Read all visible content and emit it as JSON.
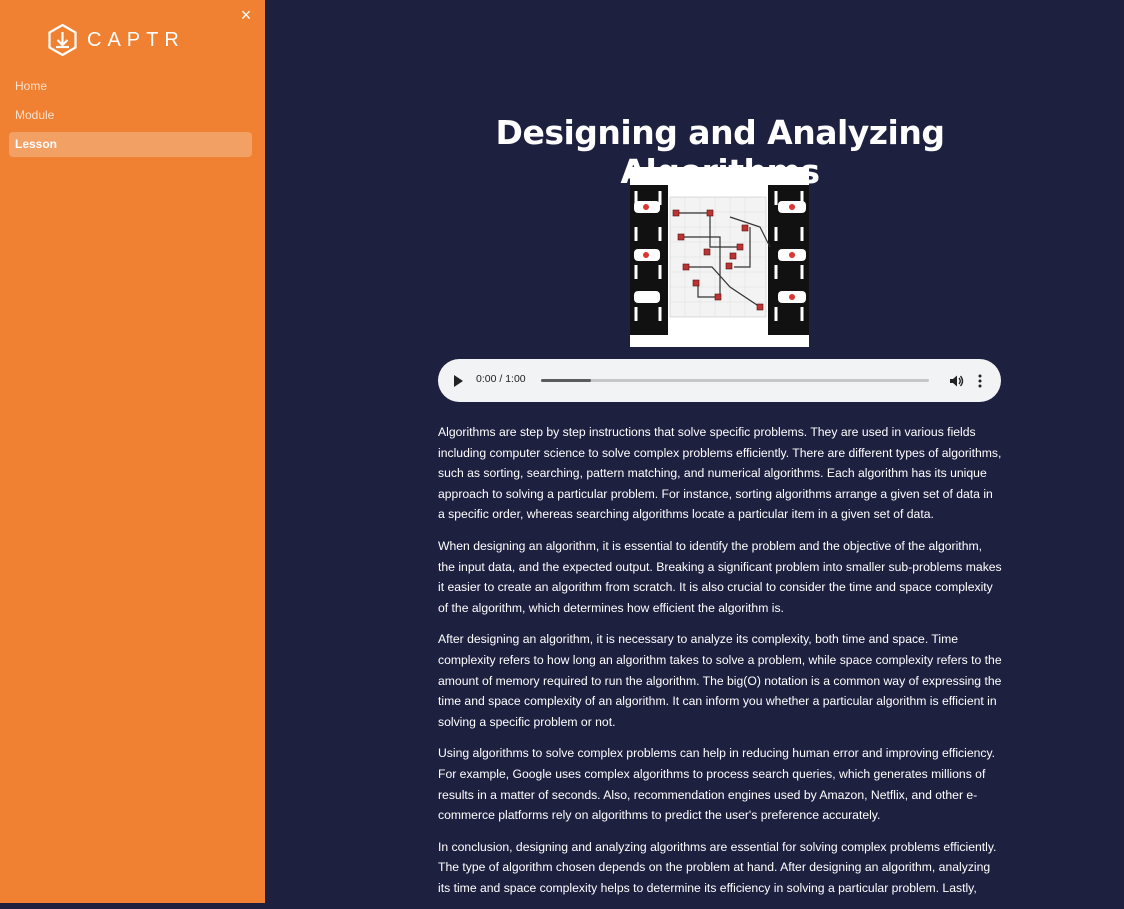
{
  "app": {
    "brand": "CAPTR"
  },
  "sidebar": {
    "close_label": "×",
    "items": [
      {
        "label": "Home",
        "active": false
      },
      {
        "label": "Module",
        "active": false
      },
      {
        "label": "Lesson",
        "active": true
      }
    ]
  },
  "lesson": {
    "title": "Designing and Analyzing Algorithms",
    "audio": {
      "time": "0:00 / 1:00",
      "progress": 0.13
    },
    "paragraphs": [
      "Algorithms are step by step instructions that solve specific problems. They are used in various fields including computer science to solve complex problems efficiently. There are different types of algorithms, such as sorting, searching, pattern matching, and numerical algorithms. Each algorithm has its unique approach to solving a particular problem. For instance, sorting algorithms arrange a given set of data in a specific order, whereas searching algorithms locate a particular item in a given set of data.",
      "When designing an algorithm, it is essential to identify the problem and the objective of the algorithm, the input data, and the expected output. Breaking a significant problem into smaller sub-problems makes it easier to create an algorithm from scratch. It is also crucial to consider the time and space complexity of the algorithm, which determines how efficient the algorithm is.",
      "After designing an algorithm, it is necessary to analyze its complexity, both time and space. Time complexity refers to how long an algorithm takes to solve a problem, while space complexity refers to the amount of memory required to run the algorithm. The big(O) notation is a common way of expressing the time and space complexity of an algorithm. It can inform you whether a particular algorithm is efficient in solving a specific problem or not.",
      "Using algorithms to solve complex problems can help in reducing human error and improving efficiency. For example, Google uses complex algorithms to process search queries, which generates millions of results in a matter of seconds. Also, recommendation engines used by Amazon, Netflix, and other e-commerce platforms rely on algorithms to predict the user's preference accurately.",
      "In conclusion, designing and analyzing algorithms are essential for solving complex problems efficiently. The type of algorithm chosen depends on the problem at hand. After designing an algorithm, analyzing its time and space complexity helps to determine its efficiency in solving a particular problem. Lastly,"
    ]
  },
  "colors": {
    "sidebar": "#f08132",
    "main_bg": "#1e2040",
    "active_item": "#f3a065"
  },
  "icons": {
    "logo": "captr-logo-icon",
    "close": "close-icon",
    "play": "play-icon",
    "volume": "volume-icon",
    "more": "more-vertical-icon"
  }
}
